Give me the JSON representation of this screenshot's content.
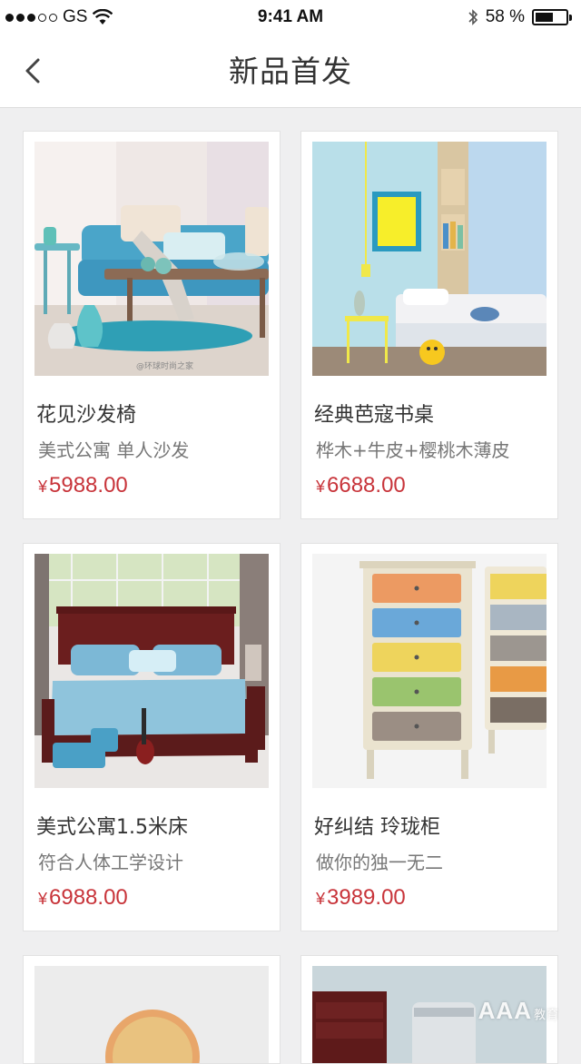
{
  "status_bar": {
    "carrier": "GS",
    "time": "9:41 AM",
    "battery_text": "58 %",
    "battery_level": 0.58,
    "signal_bars_filled": 3,
    "signal_bars_total": 5
  },
  "nav": {
    "title": "新品首发",
    "back_icon": "chevron-left-icon"
  },
  "products": [
    {
      "name": "花见沙发椅",
      "desc": "美式公寓 单人沙发",
      "price": "5988.00",
      "currency": "¥",
      "photo_caption": "@环球时尚之家"
    },
    {
      "name": "经典芭寇书桌",
      "desc": "桦木+牛皮+樱桃木薄皮",
      "price": "6688.00",
      "currency": "¥"
    },
    {
      "name": "美式公寓1.5米床",
      "desc": "符合人体工学设计",
      "price": "6988.00",
      "currency": "¥"
    },
    {
      "name": "好纠结 玲珑柜",
      "desc": "做你的独一无二",
      "price": "3989.00",
      "currency": "¥"
    }
  ],
  "watermark": {
    "text": "AAA",
    "sub": "教育"
  },
  "colors": {
    "price": "#c8343a",
    "background": "#efeff0"
  }
}
